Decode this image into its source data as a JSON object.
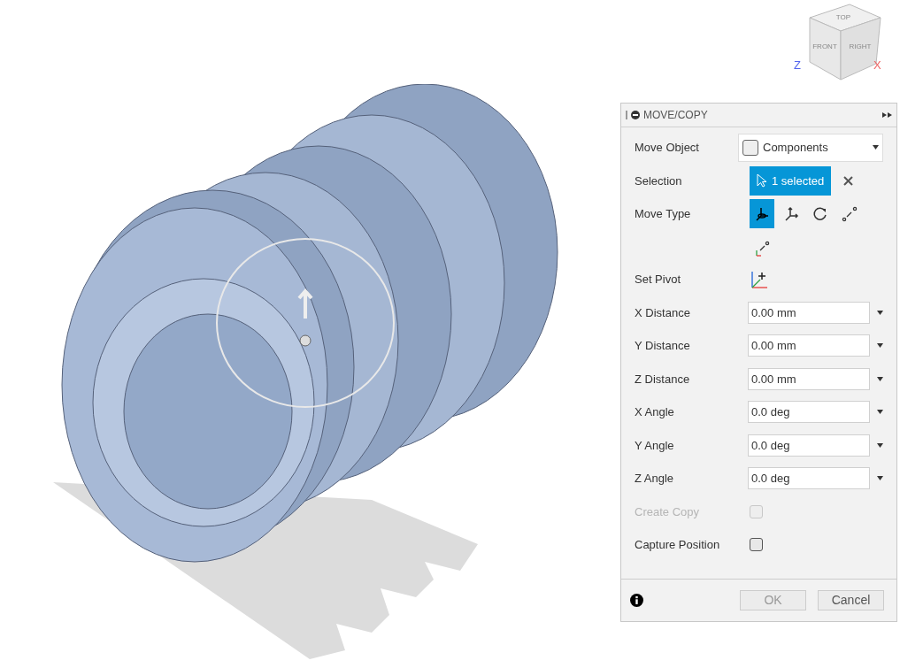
{
  "view_cube": {
    "top": "TOP",
    "front": "FRONT",
    "right": "RIGHT",
    "z_axis": "Z",
    "x_axis": "X"
  },
  "panel": {
    "title": "MOVE/COPY",
    "move_object": {
      "label": "Move Object",
      "value": "Components"
    },
    "selection": {
      "label": "Selection",
      "value": "1 selected"
    },
    "move_type": {
      "label": "Move Type",
      "options": [
        {
          "kind": "free",
          "selected": true
        },
        {
          "kind": "translate",
          "selected": false
        },
        {
          "kind": "rotate",
          "selected": false
        },
        {
          "kind": "point",
          "selected": false
        },
        {
          "kind": "axispoint",
          "selected": false
        }
      ]
    },
    "set_pivot": {
      "label": "Set Pivot"
    },
    "fields": [
      {
        "label": "X Distance",
        "value": "0.00 mm"
      },
      {
        "label": "Y Distance",
        "value": "0.00 mm"
      },
      {
        "label": "Z Distance",
        "value": "0.00 mm"
      },
      {
        "label": "X Angle",
        "value": "0.0 deg"
      },
      {
        "label": "Y Angle",
        "value": "0.0 deg"
      },
      {
        "label": "Z Angle",
        "value": "0.0 deg"
      }
    ],
    "checkboxes": [
      {
        "label": "Create Copy",
        "checked": false,
        "disabled": true
      },
      {
        "label": "Capture Position",
        "checked": false,
        "disabled": false
      }
    ],
    "buttons": {
      "ok": "OK",
      "cancel": "Cancel"
    }
  }
}
